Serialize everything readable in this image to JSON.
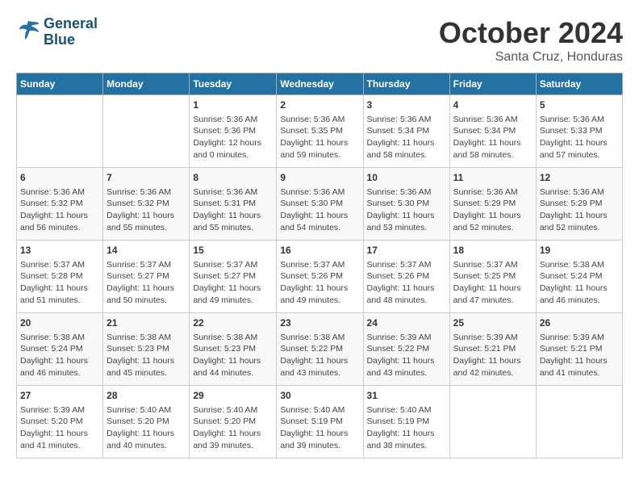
{
  "header": {
    "logo_line1": "General",
    "logo_line2": "Blue",
    "month": "October 2024",
    "location": "Santa Cruz, Honduras"
  },
  "columns": [
    "Sunday",
    "Monday",
    "Tuesday",
    "Wednesday",
    "Thursday",
    "Friday",
    "Saturday"
  ],
  "weeks": [
    [
      {
        "day": "",
        "info": ""
      },
      {
        "day": "",
        "info": ""
      },
      {
        "day": "1",
        "info": "Sunrise: 5:36 AM\nSunset: 5:36 PM\nDaylight: 12 hours\nand 0 minutes."
      },
      {
        "day": "2",
        "info": "Sunrise: 5:36 AM\nSunset: 5:35 PM\nDaylight: 11 hours\nand 59 minutes."
      },
      {
        "day": "3",
        "info": "Sunrise: 5:36 AM\nSunset: 5:34 PM\nDaylight: 11 hours\nand 58 minutes."
      },
      {
        "day": "4",
        "info": "Sunrise: 5:36 AM\nSunset: 5:34 PM\nDaylight: 11 hours\nand 58 minutes."
      },
      {
        "day": "5",
        "info": "Sunrise: 5:36 AM\nSunset: 5:33 PM\nDaylight: 11 hours\nand 57 minutes."
      }
    ],
    [
      {
        "day": "6",
        "info": "Sunrise: 5:36 AM\nSunset: 5:32 PM\nDaylight: 11 hours\nand 56 minutes."
      },
      {
        "day": "7",
        "info": "Sunrise: 5:36 AM\nSunset: 5:32 PM\nDaylight: 11 hours\nand 55 minutes."
      },
      {
        "day": "8",
        "info": "Sunrise: 5:36 AM\nSunset: 5:31 PM\nDaylight: 11 hours\nand 55 minutes."
      },
      {
        "day": "9",
        "info": "Sunrise: 5:36 AM\nSunset: 5:30 PM\nDaylight: 11 hours\nand 54 minutes."
      },
      {
        "day": "10",
        "info": "Sunrise: 5:36 AM\nSunset: 5:30 PM\nDaylight: 11 hours\nand 53 minutes."
      },
      {
        "day": "11",
        "info": "Sunrise: 5:36 AM\nSunset: 5:29 PM\nDaylight: 11 hours\nand 52 minutes."
      },
      {
        "day": "12",
        "info": "Sunrise: 5:36 AM\nSunset: 5:29 PM\nDaylight: 11 hours\nand 52 minutes."
      }
    ],
    [
      {
        "day": "13",
        "info": "Sunrise: 5:37 AM\nSunset: 5:28 PM\nDaylight: 11 hours\nand 51 minutes."
      },
      {
        "day": "14",
        "info": "Sunrise: 5:37 AM\nSunset: 5:27 PM\nDaylight: 11 hours\nand 50 minutes."
      },
      {
        "day": "15",
        "info": "Sunrise: 5:37 AM\nSunset: 5:27 PM\nDaylight: 11 hours\nand 49 minutes."
      },
      {
        "day": "16",
        "info": "Sunrise: 5:37 AM\nSunset: 5:26 PM\nDaylight: 11 hours\nand 49 minutes."
      },
      {
        "day": "17",
        "info": "Sunrise: 5:37 AM\nSunset: 5:26 PM\nDaylight: 11 hours\nand 48 minutes."
      },
      {
        "day": "18",
        "info": "Sunrise: 5:37 AM\nSunset: 5:25 PM\nDaylight: 11 hours\nand 47 minutes."
      },
      {
        "day": "19",
        "info": "Sunrise: 5:38 AM\nSunset: 5:24 PM\nDaylight: 11 hours\nand 46 minutes."
      }
    ],
    [
      {
        "day": "20",
        "info": "Sunrise: 5:38 AM\nSunset: 5:24 PM\nDaylight: 11 hours\nand 46 minutes."
      },
      {
        "day": "21",
        "info": "Sunrise: 5:38 AM\nSunset: 5:23 PM\nDaylight: 11 hours\nand 45 minutes."
      },
      {
        "day": "22",
        "info": "Sunrise: 5:38 AM\nSunset: 5:23 PM\nDaylight: 11 hours\nand 44 minutes."
      },
      {
        "day": "23",
        "info": "Sunrise: 5:38 AM\nSunset: 5:22 PM\nDaylight: 11 hours\nand 43 minutes."
      },
      {
        "day": "24",
        "info": "Sunrise: 5:39 AM\nSunset: 5:22 PM\nDaylight: 11 hours\nand 43 minutes."
      },
      {
        "day": "25",
        "info": "Sunrise: 5:39 AM\nSunset: 5:21 PM\nDaylight: 11 hours\nand 42 minutes."
      },
      {
        "day": "26",
        "info": "Sunrise: 5:39 AM\nSunset: 5:21 PM\nDaylight: 11 hours\nand 41 minutes."
      }
    ],
    [
      {
        "day": "27",
        "info": "Sunrise: 5:39 AM\nSunset: 5:20 PM\nDaylight: 11 hours\nand 41 minutes."
      },
      {
        "day": "28",
        "info": "Sunrise: 5:40 AM\nSunset: 5:20 PM\nDaylight: 11 hours\nand 40 minutes."
      },
      {
        "day": "29",
        "info": "Sunrise: 5:40 AM\nSunset: 5:20 PM\nDaylight: 11 hours\nand 39 minutes."
      },
      {
        "day": "30",
        "info": "Sunrise: 5:40 AM\nSunset: 5:19 PM\nDaylight: 11 hours\nand 39 minutes."
      },
      {
        "day": "31",
        "info": "Sunrise: 5:40 AM\nSunset: 5:19 PM\nDaylight: 11 hours\nand 38 minutes."
      },
      {
        "day": "",
        "info": ""
      },
      {
        "day": "",
        "info": ""
      }
    ]
  ]
}
